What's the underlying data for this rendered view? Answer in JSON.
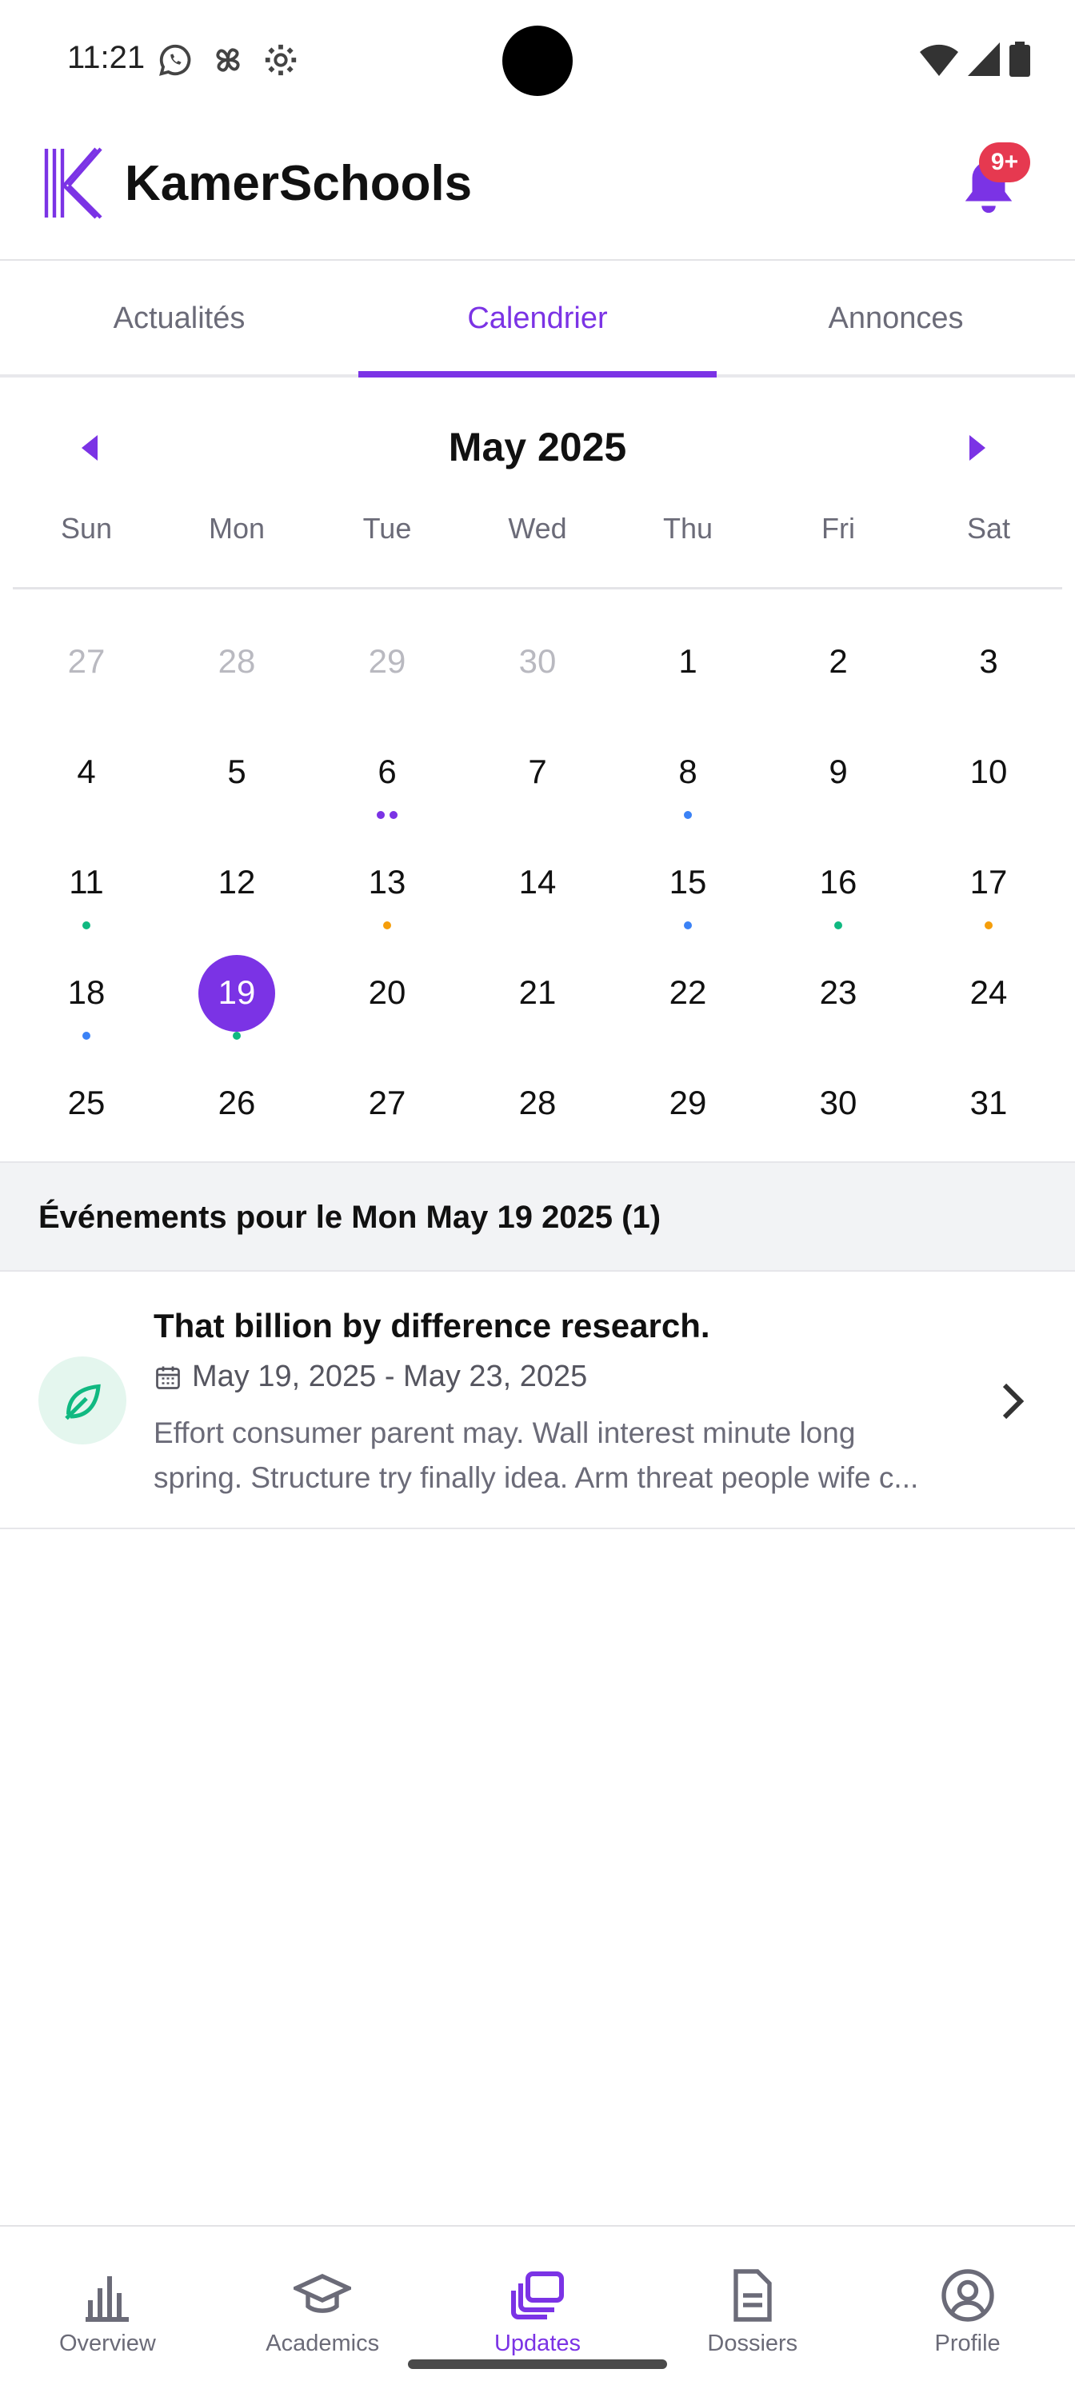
{
  "status": {
    "time": "11:21",
    "left_icons": [
      "whatsapp-icon",
      "pinwheel-icon",
      "settings-icon"
    ],
    "right_icons": [
      "wifi-icon",
      "signal-icon",
      "battery-icon"
    ]
  },
  "app": {
    "title": "KamerSchools",
    "brand_color": "#7b33e5",
    "notification_badge": "9+"
  },
  "tabs": [
    {
      "label": "Actualités",
      "active": false
    },
    {
      "label": "Calendrier",
      "active": true
    },
    {
      "label": "Annonces",
      "active": false
    }
  ],
  "calendar": {
    "month_label": "May 2025",
    "weekdays": [
      "Sun",
      "Mon",
      "Tue",
      "Wed",
      "Thu",
      "Fri",
      "Sat"
    ],
    "weeks": [
      [
        {
          "d": "27",
          "muted": true
        },
        {
          "d": "28",
          "muted": true
        },
        {
          "d": "29",
          "muted": true
        },
        {
          "d": "30",
          "muted": true
        },
        {
          "d": "1"
        },
        {
          "d": "2"
        },
        {
          "d": "3"
        }
      ],
      [
        {
          "d": "4"
        },
        {
          "d": "5"
        },
        {
          "d": "6",
          "dots": [
            "#7b33e5",
            "#7b33e5"
          ]
        },
        {
          "d": "7"
        },
        {
          "d": "8",
          "dots": [
            "#3b82f6"
          ]
        },
        {
          "d": "9"
        },
        {
          "d": "10"
        }
      ],
      [
        {
          "d": "11",
          "dots": [
            "#10b981"
          ]
        },
        {
          "d": "12"
        },
        {
          "d": "13",
          "dots": [
            "#f59e0b"
          ]
        },
        {
          "d": "14"
        },
        {
          "d": "15",
          "dots": [
            "#3b82f6"
          ]
        },
        {
          "d": "16",
          "dots": [
            "#10b981"
          ]
        },
        {
          "d": "17",
          "dots": [
            "#f59e0b"
          ]
        }
      ],
      [
        {
          "d": "18",
          "dots": [
            "#3b82f6"
          ]
        },
        {
          "d": "19",
          "selected": true,
          "dots": [
            "#10b981"
          ]
        },
        {
          "d": "20"
        },
        {
          "d": "21"
        },
        {
          "d": "22"
        },
        {
          "d": "23"
        },
        {
          "d": "24"
        }
      ],
      [
        {
          "d": "25"
        },
        {
          "d": "26"
        },
        {
          "d": "27"
        },
        {
          "d": "28"
        },
        {
          "d": "29"
        },
        {
          "d": "30"
        },
        {
          "d": "31"
        }
      ]
    ]
  },
  "events": {
    "header": "Événements pour le Mon May 19 2025 (1)",
    "items": [
      {
        "title": "That billion by difference research.",
        "date_range": "May 19, 2025 - May 23, 2025",
        "description_line1": "Effort consumer parent may. Wall interest minute long",
        "description_line2": "spring. Structure try finally idea. Arm threat people wife c...",
        "icon": "leaf-icon"
      }
    ]
  },
  "bottom_nav": [
    {
      "label": "Overview",
      "icon": "bar-chart-icon",
      "active": false
    },
    {
      "label": "Academics",
      "icon": "graduation-cap-icon",
      "active": false
    },
    {
      "label": "Updates",
      "icon": "stacked-cards-icon",
      "active": true
    },
    {
      "label": "Dossiers",
      "icon": "document-icon",
      "active": false
    },
    {
      "label": "Profile",
      "icon": "user-circle-icon",
      "active": false
    }
  ]
}
